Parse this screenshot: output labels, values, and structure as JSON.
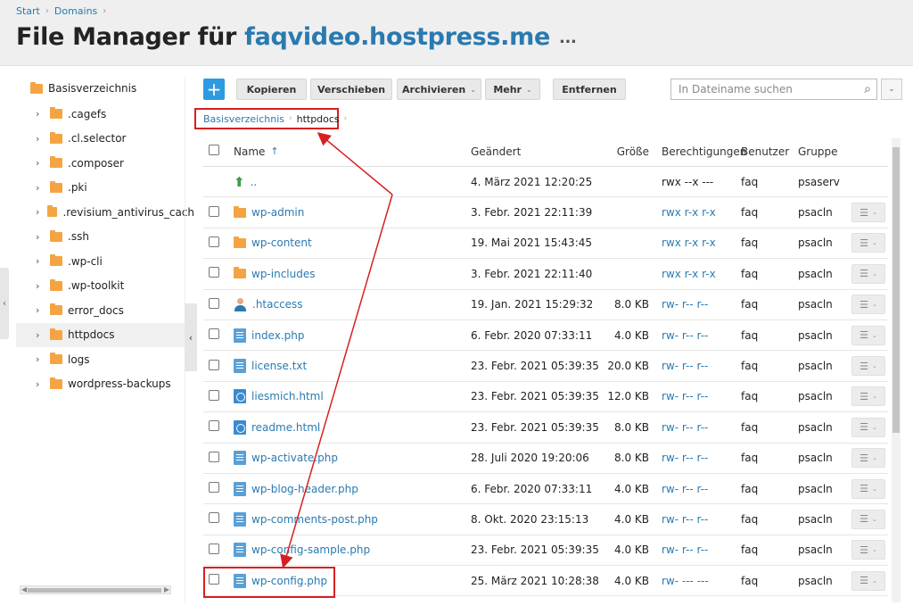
{
  "breadcrumbs": [
    "Start",
    "Domains"
  ],
  "title": {
    "prefix": "File Manager für ",
    "domain": "faqvideo.hostpress.me",
    "more": "..."
  },
  "sidebar": {
    "root": "Basisverzeichnis",
    "items": [
      {
        "label": ".cagefs",
        "selected": false
      },
      {
        "label": ".cl.selector",
        "selected": false
      },
      {
        "label": ".composer",
        "selected": false
      },
      {
        "label": ".pki",
        "selected": false
      },
      {
        "label": ".revisium_antivirus_cach",
        "selected": false
      },
      {
        "label": ".ssh",
        "selected": false
      },
      {
        "label": ".wp-cli",
        "selected": false
      },
      {
        "label": ".wp-toolkit",
        "selected": false
      },
      {
        "label": "error_docs",
        "selected": false
      },
      {
        "label": "httpdocs",
        "selected": true
      },
      {
        "label": "logs",
        "selected": false
      },
      {
        "label": "wordpress-backups",
        "selected": false
      }
    ]
  },
  "toolbar": {
    "add": "+",
    "copy": "Kopieren",
    "move": "Verschieben",
    "archive": "Archivieren",
    "more": "Mehr",
    "remove": "Entfernen",
    "search_placeholder": "In Dateiname suchen"
  },
  "path": {
    "root": "Basisverzeichnis",
    "current": "httpdocs"
  },
  "table": {
    "headers": {
      "name": "Name",
      "name_sort": "↑",
      "changed": "Geändert",
      "size": "Größe",
      "perms": "Berechtigungen",
      "user": "Benutzer",
      "group": "Gruppe"
    },
    "rows": [
      {
        "type": "up",
        "name": "..",
        "date": "4. März 2021 12:20:25",
        "size": "",
        "perm": "rwx --x ---",
        "user": "faq",
        "group": "psaserv"
      },
      {
        "type": "folder",
        "name": "wp-admin",
        "date": "3. Febr. 2021 22:11:39",
        "size": "",
        "perm": "rwx r-x r-x",
        "user": "faq",
        "group": "psacln"
      },
      {
        "type": "folder",
        "name": "wp-content",
        "date": "19. Mai 2021 15:43:45",
        "size": "",
        "perm": "rwx r-x r-x",
        "user": "faq",
        "group": "psacln"
      },
      {
        "type": "folder",
        "name": "wp-includes",
        "date": "3. Febr. 2021 22:11:40",
        "size": "",
        "perm": "rwx r-x r-x",
        "user": "faq",
        "group": "psacln"
      },
      {
        "type": "user",
        "name": ".htaccess",
        "date": "19. Jan. 2021 15:29:32",
        "size": "8.0 KB",
        "perm": "rw- r-- r--",
        "user": "faq",
        "group": "psacln"
      },
      {
        "type": "php",
        "name": "index.php",
        "date": "6. Febr. 2020 07:33:11",
        "size": "4.0 KB",
        "perm": "rw- r-- r--",
        "user": "faq",
        "group": "psacln"
      },
      {
        "type": "txt",
        "name": "license.txt",
        "date": "23. Febr. 2021 05:39:35",
        "size": "20.0 KB",
        "perm": "rw- r-- r--",
        "user": "faq",
        "group": "psacln"
      },
      {
        "type": "html",
        "name": "liesmich.html",
        "date": "23. Febr. 2021 05:39:35",
        "size": "12.0 KB",
        "perm": "rw- r-- r--",
        "user": "faq",
        "group": "psacln"
      },
      {
        "type": "html",
        "name": "readme.html",
        "date": "23. Febr. 2021 05:39:35",
        "size": "8.0 KB",
        "perm": "rw- r-- r--",
        "user": "faq",
        "group": "psacln"
      },
      {
        "type": "php",
        "name": "wp-activate.php",
        "date": "28. Juli 2020 19:20:06",
        "size": "8.0 KB",
        "perm": "rw- r-- r--",
        "user": "faq",
        "group": "psacln"
      },
      {
        "type": "php",
        "name": "wp-blog-header.php",
        "date": "6. Febr. 2020 07:33:11",
        "size": "4.0 KB",
        "perm": "rw- r-- r--",
        "user": "faq",
        "group": "psacln"
      },
      {
        "type": "php",
        "name": "wp-comments-post.php",
        "date": "8. Okt. 2020 23:15:13",
        "size": "4.0 KB",
        "perm": "rw- r-- r--",
        "user": "faq",
        "group": "psacln"
      },
      {
        "type": "php",
        "name": "wp-config-sample.php",
        "date": "23. Febr. 2021 05:39:35",
        "size": "4.0 KB",
        "perm": "rw- r-- r--",
        "user": "faq",
        "group": "psacln"
      },
      {
        "type": "php",
        "name": "wp-config.php",
        "date": "25. März 2021 10:28:38",
        "size": "4.0 KB",
        "perm": "rw- --- ---",
        "user": "faq",
        "group": "psacln"
      }
    ]
  },
  "colors": {
    "link": "#2a7ab0",
    "accent": "#2e9ae0",
    "folder": "#f5a443",
    "highlight": "#d62020"
  }
}
